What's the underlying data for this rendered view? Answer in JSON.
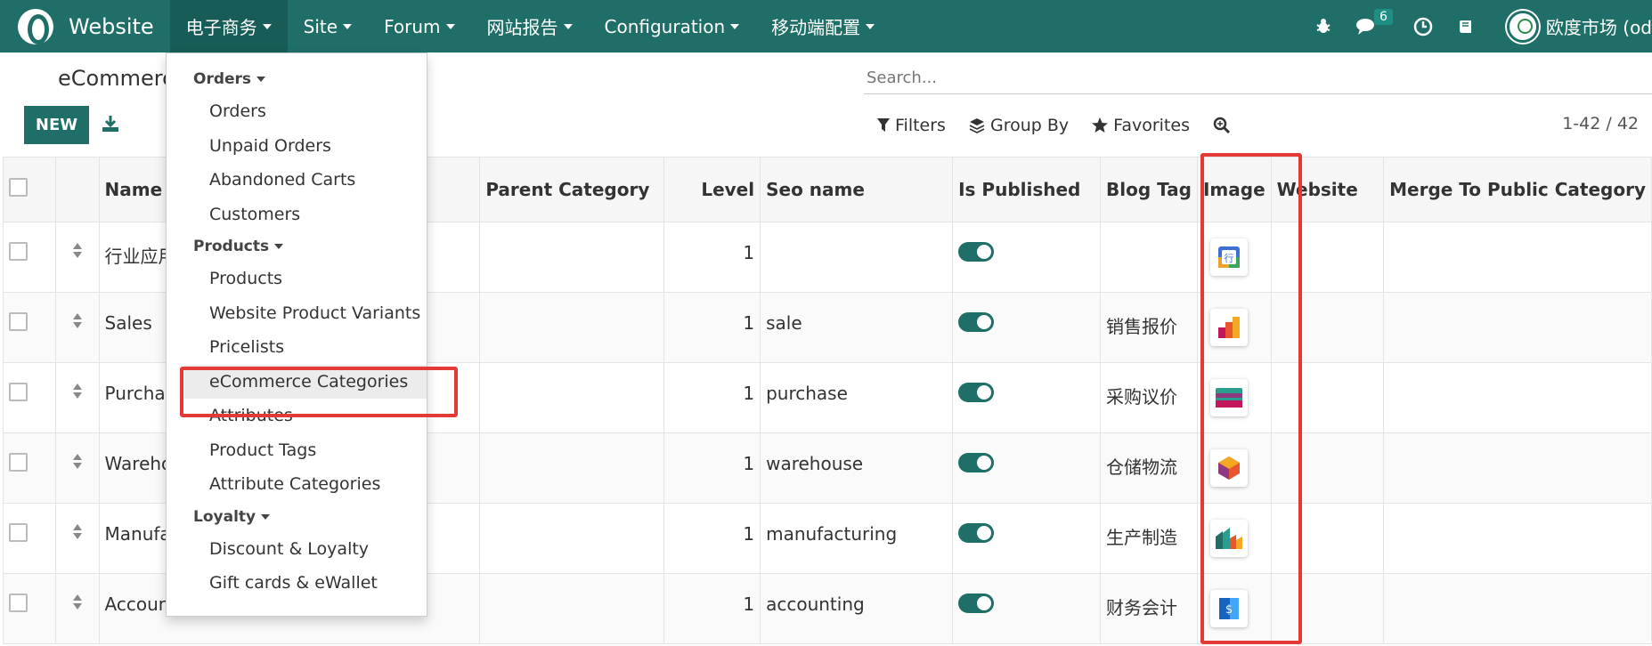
{
  "navbar": {
    "app_name": "Website",
    "menu": [
      "电子商务",
      "Site",
      "Forum",
      "网站报告",
      "Configuration",
      "移动端配置"
    ],
    "message_count": "6",
    "user_name": "欧度市场 (od"
  },
  "control_panel": {
    "breadcrumb": "eCommerce Categories",
    "new_label": "NEW",
    "search_placeholder": "Search...",
    "filters_label": "Filters",
    "group_by_label": "Group By",
    "favorites_label": "Favorites",
    "pager": "1-42 / 42"
  },
  "dropdown": {
    "sections": [
      {
        "title": "Orders",
        "items": [
          "Orders",
          "Unpaid Orders",
          "Abandoned Carts",
          "Customers"
        ]
      },
      {
        "title": "Products",
        "items": [
          "Products",
          "Website Product Variants",
          "Pricelists",
          "eCommerce Categories",
          "Attributes",
          "Product Tags",
          "Attribute Categories"
        ]
      },
      {
        "title": "Loyalty",
        "items": [
          "Discount & Loyalty",
          "Gift cards & eWallet"
        ]
      }
    ],
    "selected": "eCommerce Categories"
  },
  "table": {
    "headers": [
      "Name",
      "Parent Category",
      "Level",
      "Seo name",
      "Is Published",
      "Blog Tag",
      "Image",
      "Website",
      "Merge To Public Category"
    ],
    "rows": [
      {
        "name": "行业应用",
        "level": "1",
        "seo": "",
        "published": true,
        "blog_tag": "",
        "image": "industry-app-icon"
      },
      {
        "name": "Sales",
        "level": "1",
        "seo": "sale",
        "published": true,
        "blog_tag": "销售报价",
        "image": "sales-chart-icon"
      },
      {
        "name": "Purchase",
        "level": "1",
        "seo": "purchase",
        "published": true,
        "blog_tag": "采购议价",
        "image": "purchase-card-icon"
      },
      {
        "name": "Warehouse",
        "level": "1",
        "seo": "warehouse",
        "published": true,
        "blog_tag": "仓储物流",
        "image": "warehouse-box-icon"
      },
      {
        "name": "Manufacturing",
        "level": "1",
        "seo": "manufacturing",
        "published": true,
        "blog_tag": "生产制造",
        "image": "manufacturing-icon"
      },
      {
        "name": "Accounting",
        "level": "1",
        "seo": "accounting",
        "published": true,
        "blog_tag": "财务会计",
        "image": "accounting-dollar-icon"
      }
    ]
  },
  "colors": {
    "primary": "#1f6f68",
    "annotation": "#e53935"
  }
}
